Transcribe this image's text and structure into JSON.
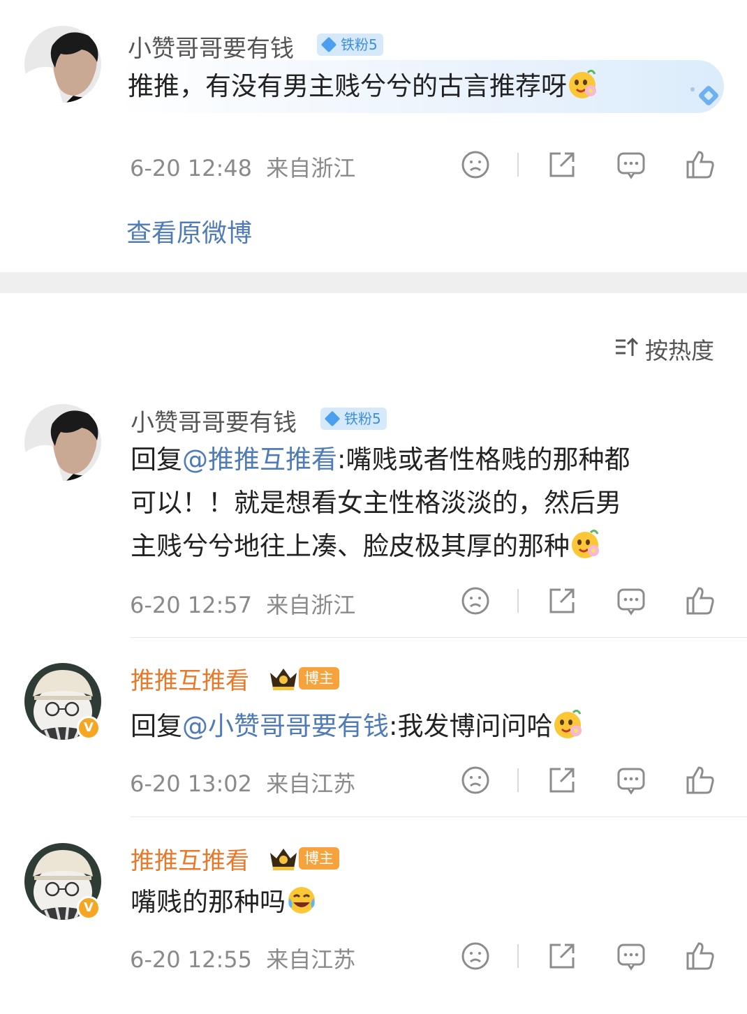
{
  "post": {
    "username": "小赞哥哥要有钱",
    "fan_badge": "铁粉5",
    "text": "推推，有没有男主贱兮兮的古言推荐呀",
    "time": "6-20 12:48",
    "location": "来自浙江",
    "view_original": "查看原微博"
  },
  "sort": {
    "label": "按热度",
    "icon": "sort-icon"
  },
  "replies": [
    {
      "username": "小赞哥哥要有钱",
      "fan_badge": "铁粉5",
      "reply_prefix": "回复",
      "mention": "@推推互推看",
      "line1": ":嘴贱或者性格贱的那种都",
      "line2": "可以！！就是想看女主性格淡淡的，然后男",
      "line3": "主贱兮兮地往上凑、脸皮极其厚的那种",
      "time": "6-20 12:57",
      "location": "来自浙江"
    },
    {
      "username": "推推互推看",
      "badge": "博主",
      "verified": "V",
      "reply_prefix": "回复",
      "mention": "@小赞哥哥要有钱",
      "text": ":我发博问问哈",
      "time": "6-20 13:02",
      "location": "来自江苏"
    },
    {
      "username": "推推互推看",
      "badge": "博主",
      "verified": "V",
      "text": "嘴贱的那种吗",
      "time": "6-20 12:55",
      "location": "来自江苏"
    }
  ],
  "actions": [
    "dislike-icon",
    "share-icon",
    "comment-icon",
    "like-icon"
  ],
  "colors": {
    "link": "#4f7bb7",
    "blogger_name": "#e8782a",
    "fan_badge": "#3c8fdc",
    "meta": "#8a8a8a"
  }
}
